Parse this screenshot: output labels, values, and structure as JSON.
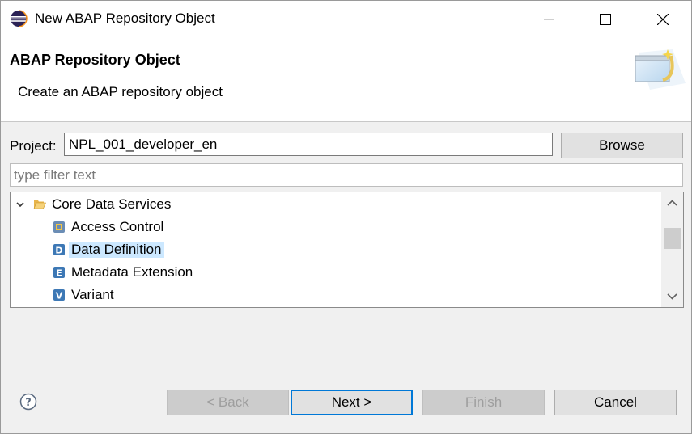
{
  "window": {
    "title": "New ABAP Repository Object"
  },
  "header": {
    "title": "ABAP Repository Object",
    "description": "Create an ABAP repository object"
  },
  "project": {
    "label": "Project:",
    "value": "NPL_001_developer_en",
    "browse_label": "Browse"
  },
  "filter": {
    "placeholder": "type filter text"
  },
  "tree": {
    "group": {
      "label": "Core Data Services",
      "expanded": true,
      "icon": "folder-open-icon"
    },
    "items": [
      {
        "label": "Access Control",
        "icon": "access-control-icon",
        "selected": false
      },
      {
        "label": "Data Definition",
        "icon": "data-definition-icon",
        "selected": true
      },
      {
        "label": "Metadata Extension",
        "icon": "metadata-extension-icon",
        "selected": false
      },
      {
        "label": "Variant",
        "icon": "variant-icon",
        "selected": false
      }
    ]
  },
  "footer": {
    "back_label": "< Back",
    "next_label": "Next >",
    "finish_label": "Finish",
    "cancel_label": "Cancel"
  },
  "colors": {
    "selection": "#cce8ff",
    "focus_border": "#0078d7"
  }
}
